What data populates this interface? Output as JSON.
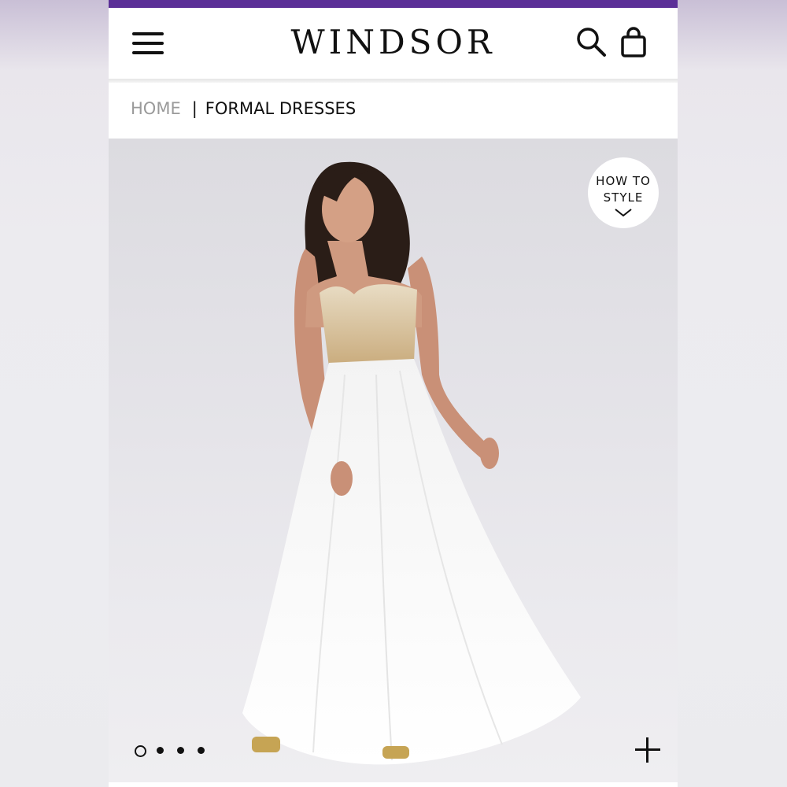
{
  "header": {
    "brand": "WINDSOR",
    "menu_icon": "hamburger-menu-icon",
    "search_icon": "search-icon",
    "bag_icon": "shopping-bag-icon",
    "accent_color": "#5b2f97"
  },
  "breadcrumb": {
    "home": "HOME",
    "separator": "|",
    "current": "FORMAL DRESSES"
  },
  "product_image": {
    "how_to_style_line1": "HOW TO",
    "how_to_style_line2": "STYLE",
    "how_to_style_icon": "chevron-down-icon",
    "carousel_count": 4,
    "carousel_active_index": 0,
    "expand_icon": "plus-icon"
  }
}
